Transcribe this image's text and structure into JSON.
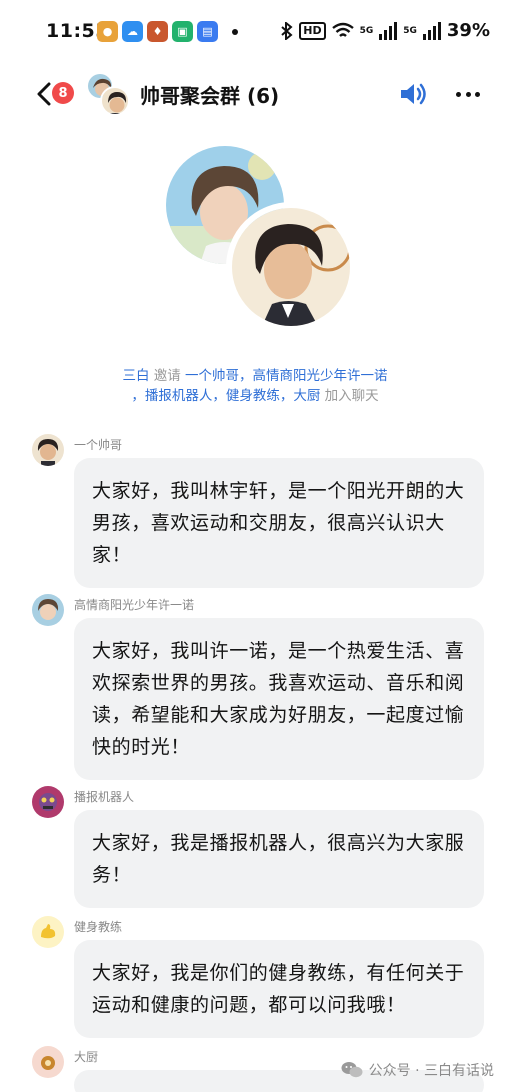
{
  "status_bar": {
    "time": "11:55",
    "hd_label": "HD",
    "net_label_1": "5G",
    "net_label_2": "5G",
    "battery": "39%"
  },
  "header": {
    "unread_count": "8",
    "title": "帅哥聚会群 (6)"
  },
  "system_notice": {
    "inviter": "三白",
    "verb_invite": "邀请",
    "invitees": [
      "一个帅哥",
      "高情商阳光少年许一诺",
      "播报机器人",
      "健身教练",
      "大厨"
    ],
    "sep": "，",
    "lead_sep": "，",
    "suffix": "加入聊天"
  },
  "messages": [
    {
      "sender": "一个帅哥",
      "lines": [
        "大家好，我叫林宇轩，是一个阳光开朗的大",
        "男孩，喜欢运动和交朋友，很高兴认识大",
        "家！"
      ]
    },
    {
      "sender": "高情商阳光少年许一诺",
      "lines": [
        "大家好，我叫许一诺，是一个热爱生活、喜",
        "欢探索世界的男孩。我喜欢运动、音乐和阅",
        "读，希望能和大家成为好朋友，一起度过愉",
        "快的时光！"
      ]
    },
    {
      "sender": "播报机器人",
      "lines": [
        "大家好，我是播报机器人，很高兴为大家服",
        "务！"
      ]
    },
    {
      "sender": "健身教练",
      "lines": [
        "大家好，我是你们的健身教练，有任何关于",
        "运动和健康的问题，都可以问我哦！"
      ]
    },
    {
      "sender": "大厨",
      "lines": []
    }
  ],
  "watermark": {
    "text": "公众号 · 三白有话说"
  },
  "colors": {
    "link": "#2f6fd6",
    "bubble": "#f1f2f3",
    "badge": "#f04a4a",
    "speaker": "#2f6fd6"
  },
  "icons": [
    "back-chevron-icon",
    "speaker-icon",
    "more-dots-icon",
    "wechat-icon",
    "bluetooth-icon",
    "wifi-icon"
  ]
}
